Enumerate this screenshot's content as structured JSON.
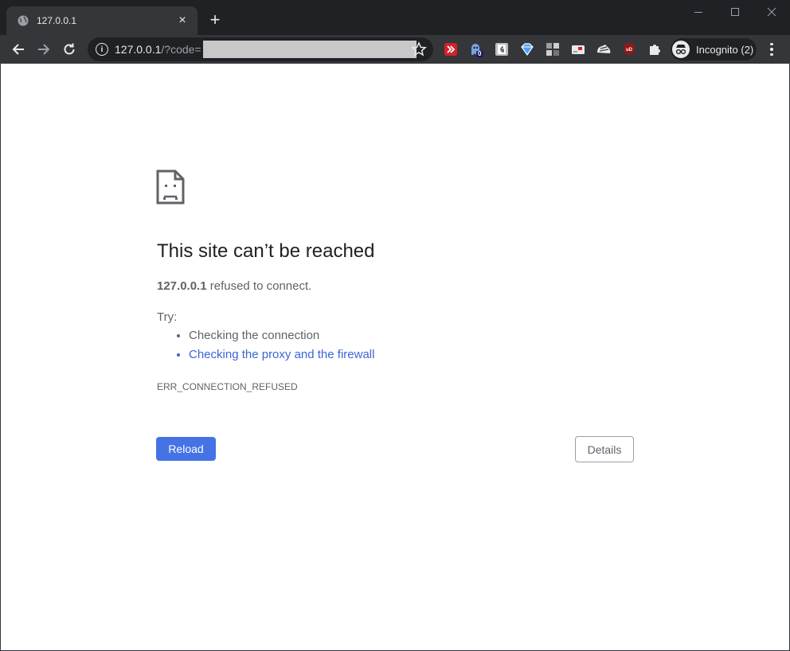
{
  "window": {
    "tab_title": "127.0.0.1",
    "new_tab_symbol": "+",
    "tab_close_symbol": "×"
  },
  "toolbar": {
    "url_host": "127.0.0.1",
    "url_path": "/?code=",
    "info_symbol": "i",
    "profile_label": "Incognito (2)",
    "extensions": [
      "readwise-icon",
      "ghostery-icon",
      "extension-g-icon",
      "diamond-extension-icon",
      "grid-extension-icon",
      "card-extension-icon",
      "shoe-extension-icon",
      "ublock-origin-icon",
      "puzzle-extensions-icon"
    ],
    "badge_count": "0"
  },
  "error_page": {
    "title": "This site can’t be reached",
    "host": "127.0.0.1",
    "message": " refused to connect.",
    "try_label": "Try:",
    "suggestions": [
      {
        "text": "Checking the connection",
        "link": false
      },
      {
        "text": "Checking the proxy and the firewall",
        "link": true
      }
    ],
    "error_code": "ERR_CONNECTION_REFUSED",
    "reload_label": "Reload",
    "details_label": "Details"
  },
  "colors": {
    "chrome_dark": "#202124",
    "toolbar": "#35363a",
    "link": "#3c64d6",
    "button_blue": "#4573e6",
    "text_gray": "#5f6368"
  }
}
